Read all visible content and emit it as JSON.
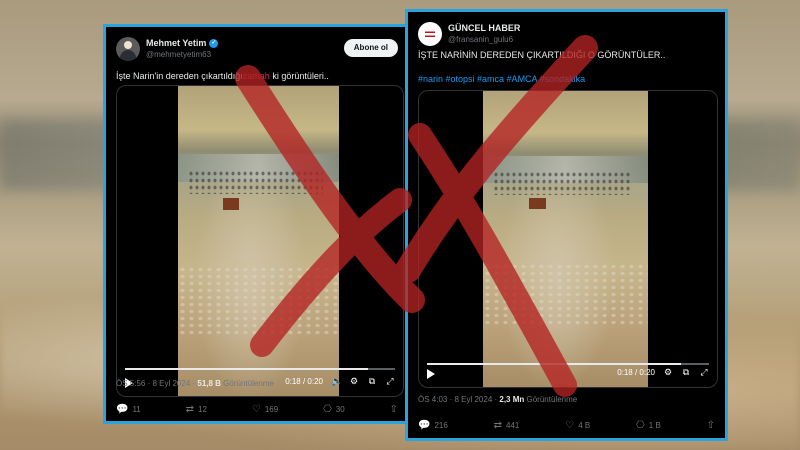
{
  "colors": {
    "accent": "#2aa3df",
    "link": "#1d9bf0",
    "cross": "#b42323"
  },
  "left_post": {
    "name": "Mehmet Yetim",
    "handle": "@mehmetyetim63",
    "follow_label": "Abone ol",
    "text_a": "İşte Narin'in dereden çıkartıldığı",
    "text_b": "zamah",
    "text_c": " ki  görüntüleri..",
    "video_time": "0:18 / 0:20",
    "progress": 0.9,
    "time": "ÖS 5:56 · 8 Eyl 2024 · ",
    "views_value": "51,8 B",
    "views_label": " Görüntülenme",
    "replies": "11",
    "reposts": "12",
    "likes": "169",
    "bookmarks": "30"
  },
  "right_post": {
    "name": "GÜNCEL HABER",
    "handle": "@fransanin_gulu6",
    "text": "İŞTE NARİNİN DEREDEN ÇIKARTILDIĞI O GÖRÜNTÜLER..",
    "hashtags": "#narin #otopsi #amca #AMCA #sondakika",
    "video_time": "0:18 / 0:20",
    "progress": 0.9,
    "time": "ÖS 4:03 · 8 Eyl 2024 · ",
    "views_value": "2,3 Mn",
    "views_label": " Görüntülenme",
    "replies": "216",
    "reposts": "441",
    "likes": "4 B",
    "bookmarks": "1 B"
  }
}
